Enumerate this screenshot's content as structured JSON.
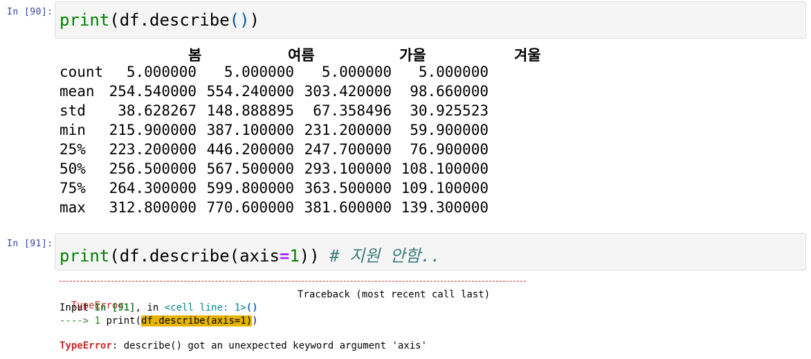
{
  "cell90": {
    "prompt": "In [90]:",
    "code": {
      "func": "print",
      "open": "(",
      "body": "df.describe",
      "close_inner": "()",
      "close": ")"
    },
    "output": {
      "columns": [
        "봄",
        "여름",
        "가을",
        "겨울"
      ],
      "rows": [
        {
          "label": "count",
          "values": [
            "5.000000",
            "5.000000",
            "5.000000",
            "5.000000"
          ]
        },
        {
          "label": "mean",
          "values": [
            "254.540000",
            "554.240000",
            "303.420000",
            "98.660000"
          ]
        },
        {
          "label": "std",
          "values": [
            "38.628267",
            "148.888895",
            "67.358496",
            "30.925523"
          ]
        },
        {
          "label": "min",
          "values": [
            "215.900000",
            "387.100000",
            "231.200000",
            "59.900000"
          ]
        },
        {
          "label": "25%",
          "values": [
            "223.200000",
            "446.200000",
            "247.700000",
            "76.900000"
          ]
        },
        {
          "label": "50%",
          "values": [
            "256.500000",
            "567.500000",
            "293.100000",
            "108.100000"
          ]
        },
        {
          "label": "75%",
          "values": [
            "264.300000",
            "599.800000",
            "363.500000",
            "109.100000"
          ]
        },
        {
          "label": "max",
          "values": [
            "312.800000",
            "770.600000",
            "381.600000",
            "139.300000"
          ]
        }
      ]
    }
  },
  "cell91": {
    "prompt": "In [91]:",
    "code": {
      "func": "print",
      "open": "(",
      "body": "df.describe(axis",
      "eq": "=",
      "num": "1",
      "close": "))",
      "comment": "# 지원 안함.."
    },
    "traceback": {
      "error_type": "TypeError",
      "header_right": "Traceback (most recent call last)",
      "input_line": {
        "prefix": "Input ",
        "in_label": "In [91]",
        "mid": ", in ",
        "cell_line": "<cell line: 1>",
        "call": "()"
      },
      "arrow_line": {
        "arrow": "----> 1 ",
        "func": "print(",
        "highlight": "df.describe(axis=1)",
        "close": ")"
      },
      "final": {
        "error_type": "TypeError",
        "message": ": describe() got an unexpected keyword argument 'axis'"
      }
    }
  }
}
